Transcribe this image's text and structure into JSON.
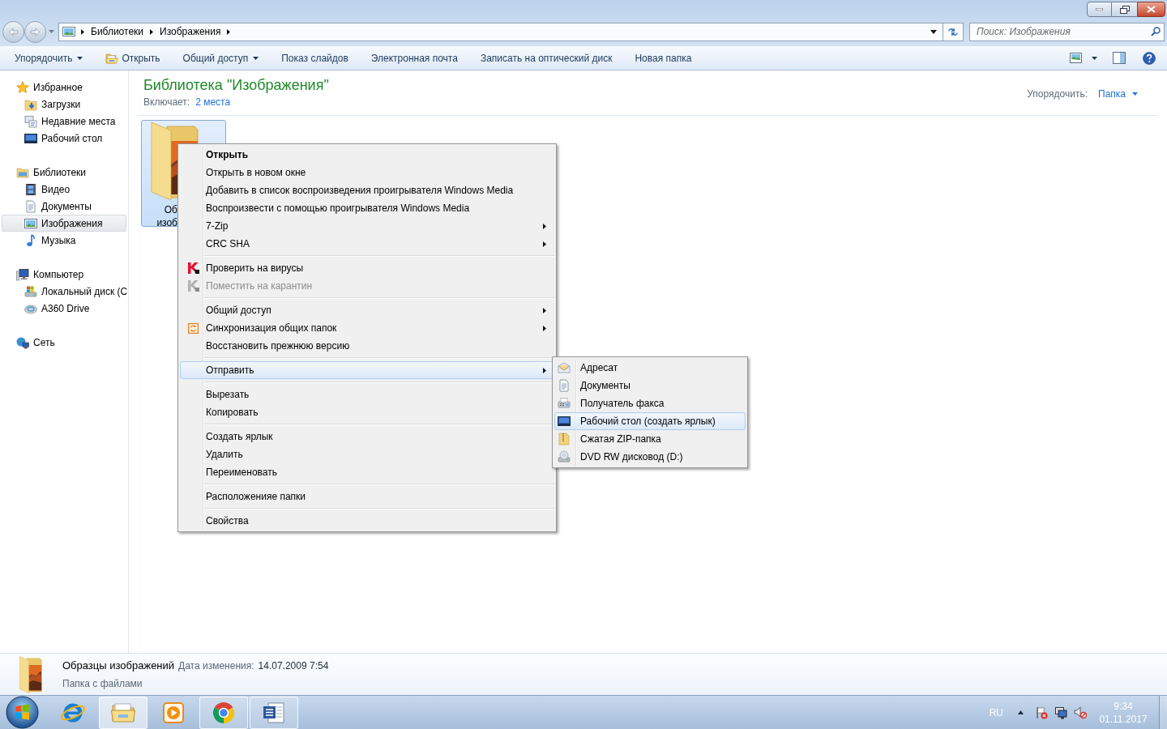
{
  "address_bar": {
    "path": [
      "Библиотеки",
      "Изображения"
    ]
  },
  "search": {
    "placeholder": "Поиск: Изображения"
  },
  "toolbar": {
    "items": [
      {
        "label": "Упорядочить",
        "kind": "menu"
      },
      {
        "label": "Открыть",
        "kind": "iconic"
      },
      {
        "label": "Общий доступ",
        "kind": "menu"
      },
      {
        "label": "Показ слайдов",
        "kind": "plain"
      },
      {
        "label": "Электронная почта",
        "kind": "plain"
      },
      {
        "label": "Записать на оптический диск",
        "kind": "plain"
      },
      {
        "label": "Новая папка",
        "kind": "plain"
      }
    ]
  },
  "sidebar": {
    "groups": [
      {
        "label": "Избранное",
        "kind": "star",
        "selected": false,
        "children": [
          {
            "label": "Загрузки",
            "kind": "downloads",
            "selected": false
          },
          {
            "label": "Недавние места",
            "kind": "recent",
            "selected": false
          },
          {
            "label": "Рабочий стол",
            "kind": "desktop",
            "selected": false
          }
        ]
      },
      {
        "label": "Библиотеки",
        "kind": "libraries",
        "selected": false,
        "children": [
          {
            "label": "Видео",
            "kind": "video",
            "selected": false
          },
          {
            "label": "Документы",
            "kind": "documents",
            "selected": false
          },
          {
            "label": "Изображения",
            "kind": "pictures",
            "selected": true
          },
          {
            "label": "Музыка",
            "kind": "music",
            "selected": false
          }
        ]
      },
      {
        "label": "Компьютер",
        "kind": "computer",
        "selected": false,
        "children": [
          {
            "label": "Локальный диск (C",
            "kind": "disk",
            "selected": false
          },
          {
            "label": "A360 Drive",
            "kind": "cloud",
            "selected": false
          }
        ]
      },
      {
        "label": "Сеть",
        "kind": "network",
        "selected": false
      }
    ]
  },
  "library": {
    "title": "Библиотека \"Изображения\"",
    "includes_label": "Включает:",
    "includes_link": "2 места",
    "arrange_label": "Упорядочить:",
    "arrange_value": "Папка"
  },
  "files": [
    {
      "label_lines": [
        "Об",
        "изоб"
      ],
      "selected": true
    }
  ],
  "context_menu": {
    "sections": [
      {
        "items": [
          {
            "label": "Открыть",
            "kind": "text",
            "default": true,
            "submenu": false,
            "disabled": false,
            "selected": false
          },
          {
            "label": "Открыть в новом окне",
            "kind": "text",
            "default": false,
            "submenu": false,
            "disabled": false,
            "selected": false
          },
          {
            "label": "Добавить в список воспроизведения проигрывателя Windows Media",
            "kind": "text",
            "default": false,
            "submenu": false,
            "disabled": false,
            "selected": false
          },
          {
            "label": "Воспроизвести с помощью проигрывателя Windows Media",
            "kind": "text",
            "default": false,
            "submenu": false,
            "disabled": false,
            "selected": false
          },
          {
            "label": "7-Zip",
            "kind": "text",
            "default": false,
            "submenu": true,
            "disabled": false,
            "selected": false
          },
          {
            "label": "CRC SHA",
            "kind": "text",
            "default": false,
            "submenu": true,
            "disabled": false,
            "selected": false
          }
        ]
      },
      {
        "items": [
          {
            "label": "Проверить на вирусы",
            "kind": "scan",
            "default": false,
            "submenu": false,
            "disabled": false,
            "selected": false
          },
          {
            "label": "Поместить на карантин",
            "kind": "scan",
            "default": false,
            "submenu": false,
            "disabled": true,
            "selected": false
          }
        ]
      },
      {
        "items": [
          {
            "label": "Общий доступ",
            "kind": "text",
            "default": false,
            "submenu": true,
            "disabled": false,
            "selected": false
          },
          {
            "label": "Синхронизация общих папок",
            "kind": "sync",
            "default": false,
            "submenu": true,
            "disabled": false,
            "selected": false
          },
          {
            "label": "Восстановить прежнюю версию",
            "kind": "text",
            "default": false,
            "submenu": false,
            "disabled": false,
            "selected": false
          }
        ]
      },
      {
        "items": [
          {
            "label": "Отправить",
            "kind": "text",
            "default": false,
            "submenu": true,
            "disabled": false,
            "selected": true
          }
        ]
      },
      {
        "items": [
          {
            "label": "Вырезать",
            "kind": "text",
            "default": false,
            "submenu": false,
            "disabled": false,
            "selected": false
          },
          {
            "label": "Копировать",
            "kind": "text",
            "default": false,
            "submenu": false,
            "disabled": false,
            "selected": false
          }
        ]
      },
      {
        "items": [
          {
            "label": "Создать ярлык",
            "kind": "text",
            "default": false,
            "submenu": false,
            "disabled": false,
            "selected": false
          },
          {
            "label": "Удалить",
            "kind": "text",
            "default": false,
            "submenu": false,
            "disabled": false,
            "selected": false
          },
          {
            "label": "Переименовать",
            "kind": "text",
            "default": false,
            "submenu": false,
            "disabled": false,
            "selected": false
          }
        ]
      },
      {
        "items": [
          {
            "label": "Расположенияе папки",
            "kind": "text",
            "default": false,
            "submenu": false,
            "disabled": false,
            "selected": false
          }
        ]
      },
      {
        "items": [
          {
            "label": "Свойства",
            "kind": "text",
            "default": false,
            "submenu": false,
            "disabled": false,
            "selected": false
          }
        ]
      }
    ]
  },
  "send_to_menu": {
    "items": [
      {
        "label": "Адресат",
        "kind": "mail",
        "selected": false
      },
      {
        "label": "Документы",
        "kind": "documents",
        "selected": false
      },
      {
        "label": "Получатель факса",
        "kind": "fax",
        "selected": false
      },
      {
        "label": "Рабочий стол (создать ярлык)",
        "kind": "desktop",
        "selected": true
      },
      {
        "label": "Сжатая ZIP-папка",
        "kind": "zip",
        "selected": false
      },
      {
        "label": "DVD RW дисковод (D:)",
        "kind": "dvd",
        "selected": false
      }
    ]
  },
  "details": {
    "name": "Образцы изображений",
    "date_label": "Дата изменения:",
    "date": "14.07.2009 7:54",
    "type": "Папка с файлами"
  },
  "taskbar": {
    "apps": [
      {
        "kind": "globe",
        "running": false,
        "selected": false
      },
      {
        "kind": "folder",
        "running": true,
        "selected": true
      },
      {
        "kind": "play",
        "running": false,
        "selected": false
      },
      {
        "kind": "circle",
        "running": true,
        "selected": false
      },
      {
        "kind": "document",
        "running": true,
        "selected": false
      }
    ],
    "language": "RU",
    "time": "9:34",
    "date": "01.11.2017"
  }
}
